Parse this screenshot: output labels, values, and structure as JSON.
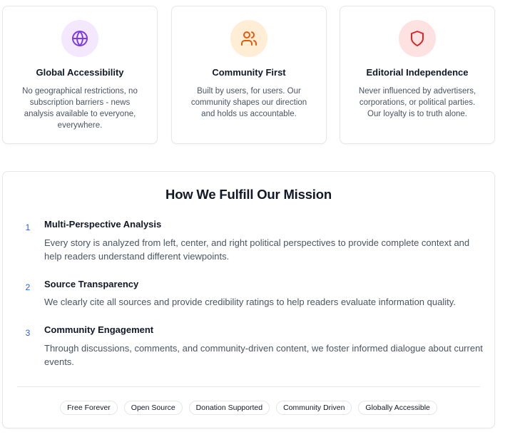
{
  "values_cards": [
    {
      "title": "Global Accessibility",
      "description": "No geographical restrictions, no subscription barriers - news analysis available to everyone, everywhere.",
      "icon": "globe-icon",
      "icon_color": "#7c3aed",
      "icon_bg": "#f3e8ff"
    },
    {
      "title": "Community First",
      "description": "Built by users, for users. Our community shapes our direction and holds us accountable.",
      "icon": "users-icon",
      "icon_color": "#ea580c",
      "icon_bg": "#ffedd5"
    },
    {
      "title": "Editorial Independence",
      "description": "Never influenced by advertisers, corporations, or political parties. Our loyalty is to truth alone.",
      "icon": "shield-icon",
      "icon_color": "#dc2626",
      "icon_bg": "#fee2e2"
    }
  ],
  "mission": {
    "title": "How We Fulfill Our Mission",
    "steps": [
      {
        "number": "1",
        "title": "Multi-Perspective Analysis",
        "description": "Every story is analyzed from left, center, and right political perspectives to provide complete context and help readers understand different viewpoints."
      },
      {
        "number": "2",
        "title": "Source Transparency",
        "description": "We clearly cite all sources and provide credibility ratings to help readers evaluate information quality."
      },
      {
        "number": "3",
        "title": "Community Engagement",
        "description": "Through discussions, comments, and community-driven content, we foster informed dialogue about current events."
      }
    ],
    "tags": [
      "Free Forever",
      "Open Source",
      "Donation Supported",
      "Community Driven",
      "Globally Accessible"
    ],
    "accent_color": "#2563eb"
  }
}
